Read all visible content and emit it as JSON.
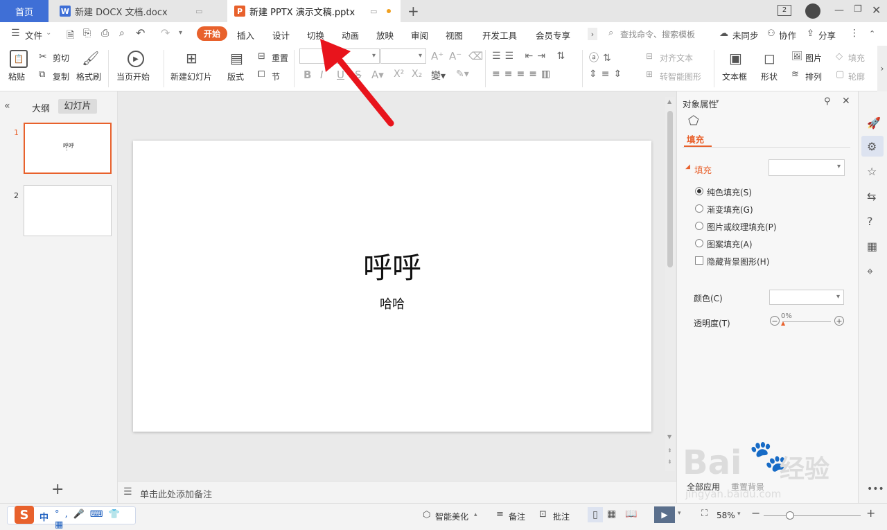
{
  "tabs": {
    "home": "首页",
    "docx": "新建 DOCX 文档.docx",
    "pptx": "新建 PPTX 演示文稿.pptx",
    "window_count": "2"
  },
  "menu": {
    "file": "文件",
    "items": [
      "开始",
      "插入",
      "设计",
      "切换",
      "动画",
      "放映",
      "审阅",
      "视图",
      "开发工具",
      "会员专享"
    ],
    "search": "查找命令、搜索模板",
    "sync": "未同步",
    "collab": "协作",
    "share": "分享"
  },
  "ribbon": {
    "paste": "粘贴",
    "cut": "剪切",
    "copy": "复制",
    "format_painter": "格式刷",
    "from_current": "当页开始",
    "new_slide": "新建幻灯片",
    "layout": "版式",
    "reset": "重置",
    "section": "节",
    "align_text": "对齐文本",
    "smart_shape": "转智能图形",
    "textbox": "文本框",
    "shape": "形状",
    "picture": "图片",
    "arrange": "排列",
    "fill": "填充",
    "outline": "轮廓"
  },
  "left": {
    "outline_tab": "大纲",
    "slides_tab": "幻灯片",
    "slide_numbers": [
      "1",
      "2"
    ],
    "thumb_title": "呼呼",
    "thumb_sub": "-"
  },
  "slide": {
    "title": "呼呼",
    "subtitle": "哈哈"
  },
  "notes": {
    "placeholder": "单击此处添加备注"
  },
  "pane": {
    "header": "对象属性",
    "fill_tab": "填充",
    "fill_section": "填充",
    "options": [
      "纯色填充(S)",
      "渐变填充(G)",
      "图片或纹理填充(P)",
      "图案填充(A)"
    ],
    "hide_bg": "隐藏背景图形(H)",
    "color_label": "颜色(C)",
    "transparency_label": "透明度(T)",
    "transparency_value": "0%",
    "apply_all": "全部应用",
    "reset_bg": "重置背景"
  },
  "status": {
    "ime": "中",
    "beautify": "智能美化",
    "notes": "备注",
    "comment": "批注",
    "zoom": "58%"
  },
  "watermark": {
    "brand": "Bai",
    "brand2": "经验",
    "url": "jingyan.baidu.com"
  },
  "colors": {
    "accent": "#e8612c",
    "home_tab": "#3f6fd6",
    "arrow": "#e8141c"
  }
}
